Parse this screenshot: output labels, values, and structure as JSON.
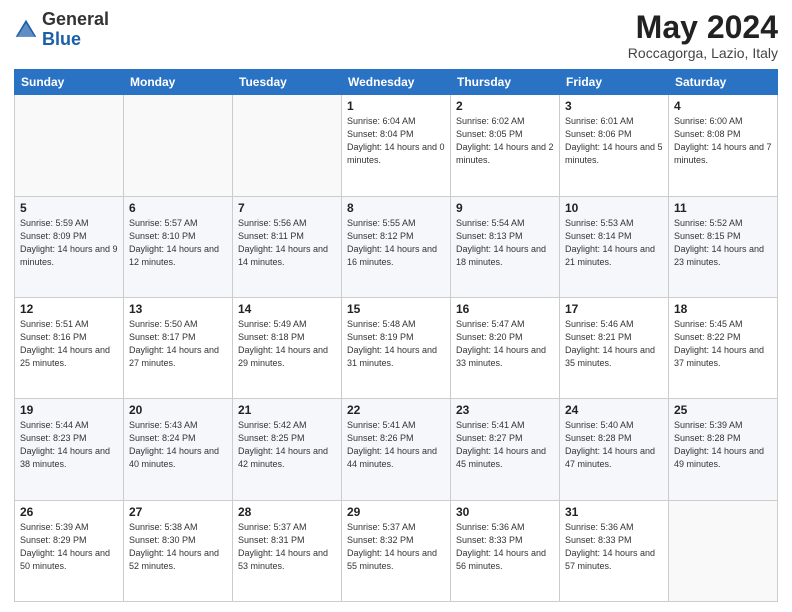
{
  "header": {
    "logo_general": "General",
    "logo_blue": "Blue",
    "month_year": "May 2024",
    "location": "Roccagorga, Lazio, Italy"
  },
  "days_of_week": [
    "Sunday",
    "Monday",
    "Tuesday",
    "Wednesday",
    "Thursday",
    "Friday",
    "Saturday"
  ],
  "weeks": [
    [
      {
        "day": "",
        "sunrise": "",
        "sunset": "",
        "daylight": ""
      },
      {
        "day": "",
        "sunrise": "",
        "sunset": "",
        "daylight": ""
      },
      {
        "day": "",
        "sunrise": "",
        "sunset": "",
        "daylight": ""
      },
      {
        "day": "1",
        "sunrise": "Sunrise: 6:04 AM",
        "sunset": "Sunset: 8:04 PM",
        "daylight": "Daylight: 14 hours and 0 minutes."
      },
      {
        "day": "2",
        "sunrise": "Sunrise: 6:02 AM",
        "sunset": "Sunset: 8:05 PM",
        "daylight": "Daylight: 14 hours and 2 minutes."
      },
      {
        "day": "3",
        "sunrise": "Sunrise: 6:01 AM",
        "sunset": "Sunset: 8:06 PM",
        "daylight": "Daylight: 14 hours and 5 minutes."
      },
      {
        "day": "4",
        "sunrise": "Sunrise: 6:00 AM",
        "sunset": "Sunset: 8:08 PM",
        "daylight": "Daylight: 14 hours and 7 minutes."
      }
    ],
    [
      {
        "day": "5",
        "sunrise": "Sunrise: 5:59 AM",
        "sunset": "Sunset: 8:09 PM",
        "daylight": "Daylight: 14 hours and 9 minutes."
      },
      {
        "day": "6",
        "sunrise": "Sunrise: 5:57 AM",
        "sunset": "Sunset: 8:10 PM",
        "daylight": "Daylight: 14 hours and 12 minutes."
      },
      {
        "day": "7",
        "sunrise": "Sunrise: 5:56 AM",
        "sunset": "Sunset: 8:11 PM",
        "daylight": "Daylight: 14 hours and 14 minutes."
      },
      {
        "day": "8",
        "sunrise": "Sunrise: 5:55 AM",
        "sunset": "Sunset: 8:12 PM",
        "daylight": "Daylight: 14 hours and 16 minutes."
      },
      {
        "day": "9",
        "sunrise": "Sunrise: 5:54 AM",
        "sunset": "Sunset: 8:13 PM",
        "daylight": "Daylight: 14 hours and 18 minutes."
      },
      {
        "day": "10",
        "sunrise": "Sunrise: 5:53 AM",
        "sunset": "Sunset: 8:14 PM",
        "daylight": "Daylight: 14 hours and 21 minutes."
      },
      {
        "day": "11",
        "sunrise": "Sunrise: 5:52 AM",
        "sunset": "Sunset: 8:15 PM",
        "daylight": "Daylight: 14 hours and 23 minutes."
      }
    ],
    [
      {
        "day": "12",
        "sunrise": "Sunrise: 5:51 AM",
        "sunset": "Sunset: 8:16 PM",
        "daylight": "Daylight: 14 hours and 25 minutes."
      },
      {
        "day": "13",
        "sunrise": "Sunrise: 5:50 AM",
        "sunset": "Sunset: 8:17 PM",
        "daylight": "Daylight: 14 hours and 27 minutes."
      },
      {
        "day": "14",
        "sunrise": "Sunrise: 5:49 AM",
        "sunset": "Sunset: 8:18 PM",
        "daylight": "Daylight: 14 hours and 29 minutes."
      },
      {
        "day": "15",
        "sunrise": "Sunrise: 5:48 AM",
        "sunset": "Sunset: 8:19 PM",
        "daylight": "Daylight: 14 hours and 31 minutes."
      },
      {
        "day": "16",
        "sunrise": "Sunrise: 5:47 AM",
        "sunset": "Sunset: 8:20 PM",
        "daylight": "Daylight: 14 hours and 33 minutes."
      },
      {
        "day": "17",
        "sunrise": "Sunrise: 5:46 AM",
        "sunset": "Sunset: 8:21 PM",
        "daylight": "Daylight: 14 hours and 35 minutes."
      },
      {
        "day": "18",
        "sunrise": "Sunrise: 5:45 AM",
        "sunset": "Sunset: 8:22 PM",
        "daylight": "Daylight: 14 hours and 37 minutes."
      }
    ],
    [
      {
        "day": "19",
        "sunrise": "Sunrise: 5:44 AM",
        "sunset": "Sunset: 8:23 PM",
        "daylight": "Daylight: 14 hours and 38 minutes."
      },
      {
        "day": "20",
        "sunrise": "Sunrise: 5:43 AM",
        "sunset": "Sunset: 8:24 PM",
        "daylight": "Daylight: 14 hours and 40 minutes."
      },
      {
        "day": "21",
        "sunrise": "Sunrise: 5:42 AM",
        "sunset": "Sunset: 8:25 PM",
        "daylight": "Daylight: 14 hours and 42 minutes."
      },
      {
        "day": "22",
        "sunrise": "Sunrise: 5:41 AM",
        "sunset": "Sunset: 8:26 PM",
        "daylight": "Daylight: 14 hours and 44 minutes."
      },
      {
        "day": "23",
        "sunrise": "Sunrise: 5:41 AM",
        "sunset": "Sunset: 8:27 PM",
        "daylight": "Daylight: 14 hours and 45 minutes."
      },
      {
        "day": "24",
        "sunrise": "Sunrise: 5:40 AM",
        "sunset": "Sunset: 8:28 PM",
        "daylight": "Daylight: 14 hours and 47 minutes."
      },
      {
        "day": "25",
        "sunrise": "Sunrise: 5:39 AM",
        "sunset": "Sunset: 8:28 PM",
        "daylight": "Daylight: 14 hours and 49 minutes."
      }
    ],
    [
      {
        "day": "26",
        "sunrise": "Sunrise: 5:39 AM",
        "sunset": "Sunset: 8:29 PM",
        "daylight": "Daylight: 14 hours and 50 minutes."
      },
      {
        "day": "27",
        "sunrise": "Sunrise: 5:38 AM",
        "sunset": "Sunset: 8:30 PM",
        "daylight": "Daylight: 14 hours and 52 minutes."
      },
      {
        "day": "28",
        "sunrise": "Sunrise: 5:37 AM",
        "sunset": "Sunset: 8:31 PM",
        "daylight": "Daylight: 14 hours and 53 minutes."
      },
      {
        "day": "29",
        "sunrise": "Sunrise: 5:37 AM",
        "sunset": "Sunset: 8:32 PM",
        "daylight": "Daylight: 14 hours and 55 minutes."
      },
      {
        "day": "30",
        "sunrise": "Sunrise: 5:36 AM",
        "sunset": "Sunset: 8:33 PM",
        "daylight": "Daylight: 14 hours and 56 minutes."
      },
      {
        "day": "31",
        "sunrise": "Sunrise: 5:36 AM",
        "sunset": "Sunset: 8:33 PM",
        "daylight": "Daylight: 14 hours and 57 minutes."
      },
      {
        "day": "",
        "sunrise": "",
        "sunset": "",
        "daylight": ""
      }
    ]
  ]
}
